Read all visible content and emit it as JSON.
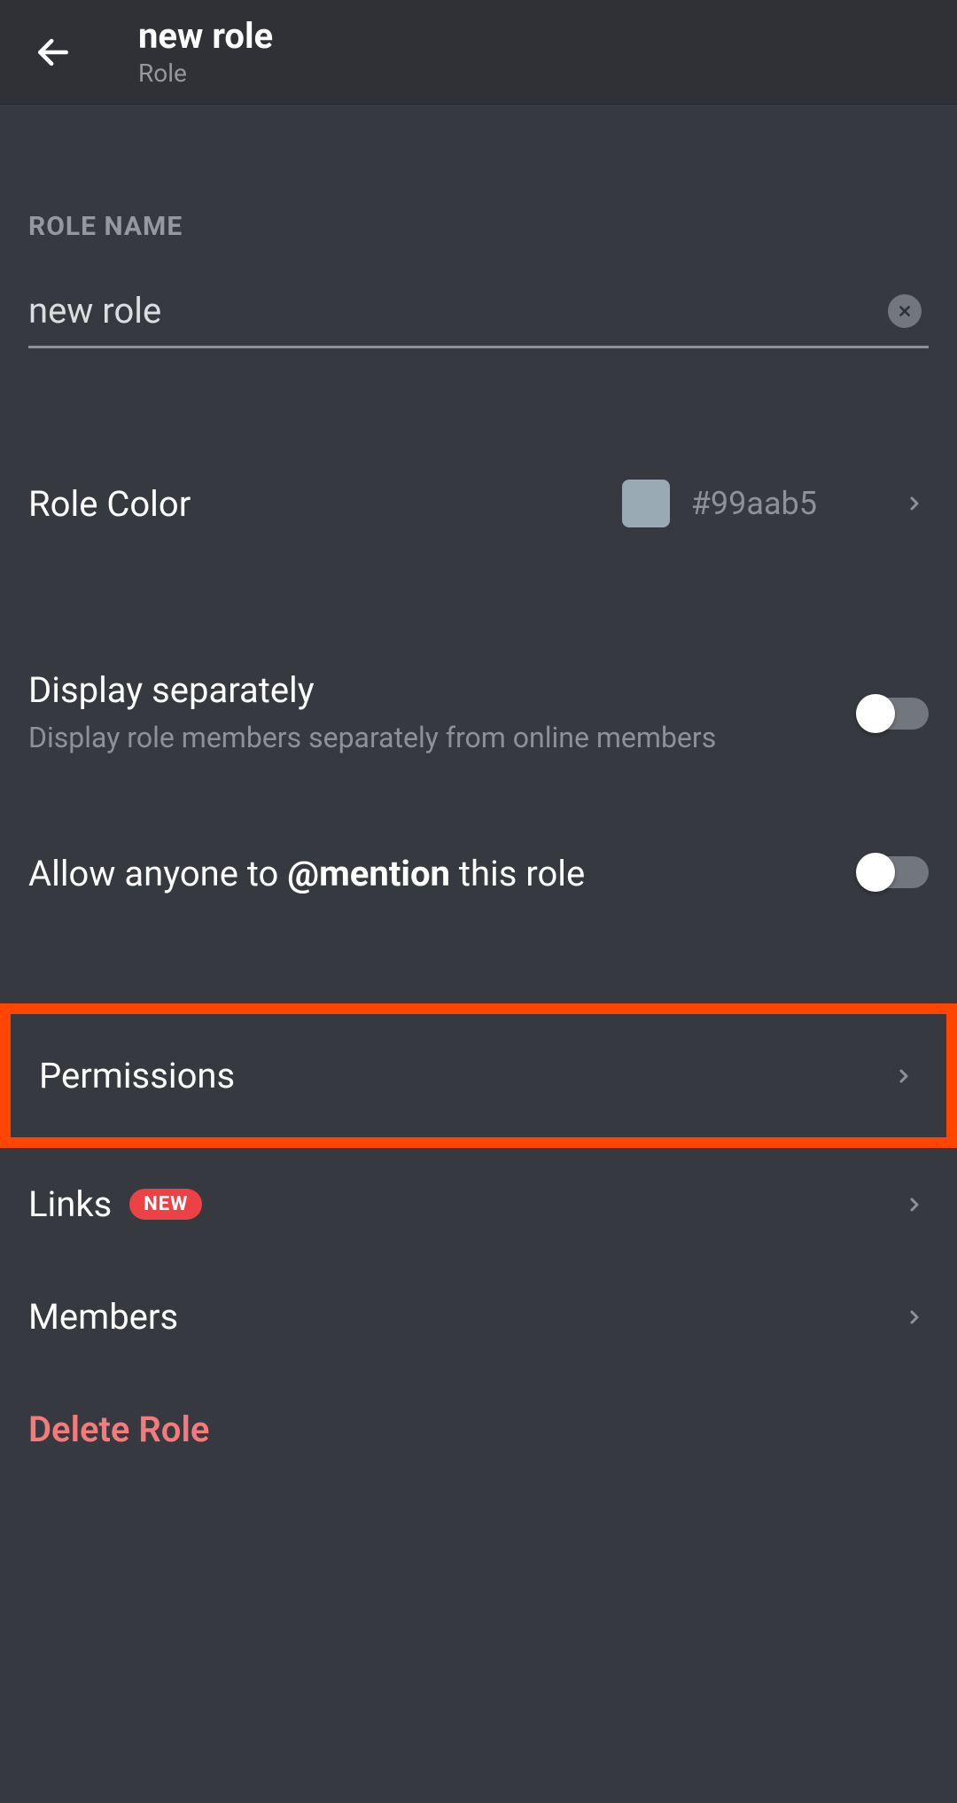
{
  "header": {
    "title": "new role",
    "subtitle": "Role"
  },
  "roleName": {
    "label": "ROLE NAME",
    "value": "new role"
  },
  "roleColor": {
    "label": "Role Color",
    "value": "#99aab5",
    "swatch": "#99aab5"
  },
  "displaySeparately": {
    "title": "Display separately",
    "description": "Display role members separately from online members"
  },
  "allowMention": {
    "prefix": "Allow anyone to ",
    "bold": "@mention",
    "suffix": " this role"
  },
  "nav": {
    "permissions": "Permissions",
    "links": "Links",
    "linksBadge": "NEW",
    "members": "Members"
  },
  "delete": {
    "label": "Delete Role"
  }
}
